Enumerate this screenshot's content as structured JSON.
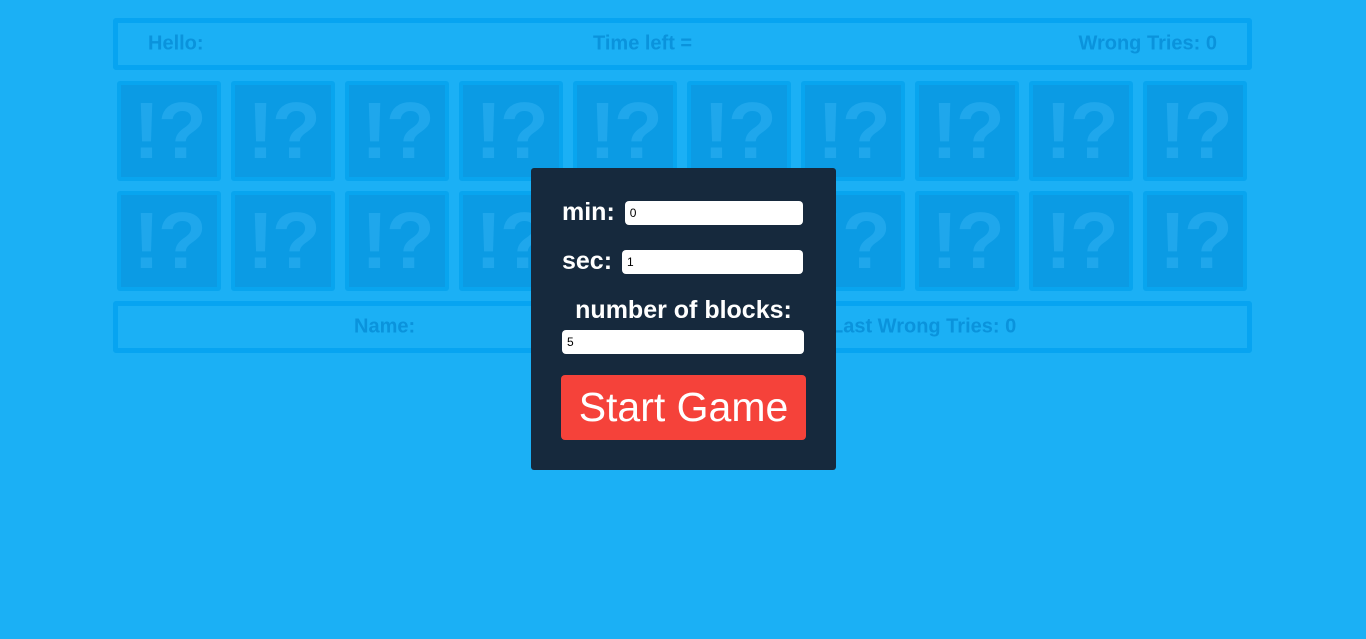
{
  "header": {
    "hello": "Hello:",
    "time_left": "Time left =",
    "wrong_tries": "Wrong Tries: 0"
  },
  "footer": {
    "name": "Name:",
    "last_wrong_tries": "Last Wrong Tries: 0"
  },
  "blocks": {
    "row1": [
      "!?",
      "!?",
      "!?",
      "!?",
      "!?",
      "!?",
      "!?",
      "!?",
      "!?",
      "!?"
    ],
    "row2": [
      "!?",
      "!?",
      "!?",
      "!?",
      "!?",
      "!?",
      "!?",
      "!?",
      "!?",
      "!?"
    ]
  },
  "settings": {
    "min_label": "min:",
    "min_value": "0",
    "sec_label": "sec:",
    "sec_value": "1",
    "blocks_label": "number of blocks:",
    "blocks_value": "5",
    "start_label": "Start Game"
  },
  "colors": {
    "background": "#1bb0f5",
    "modal": "#16293d",
    "start_button": "#f5423a"
  }
}
